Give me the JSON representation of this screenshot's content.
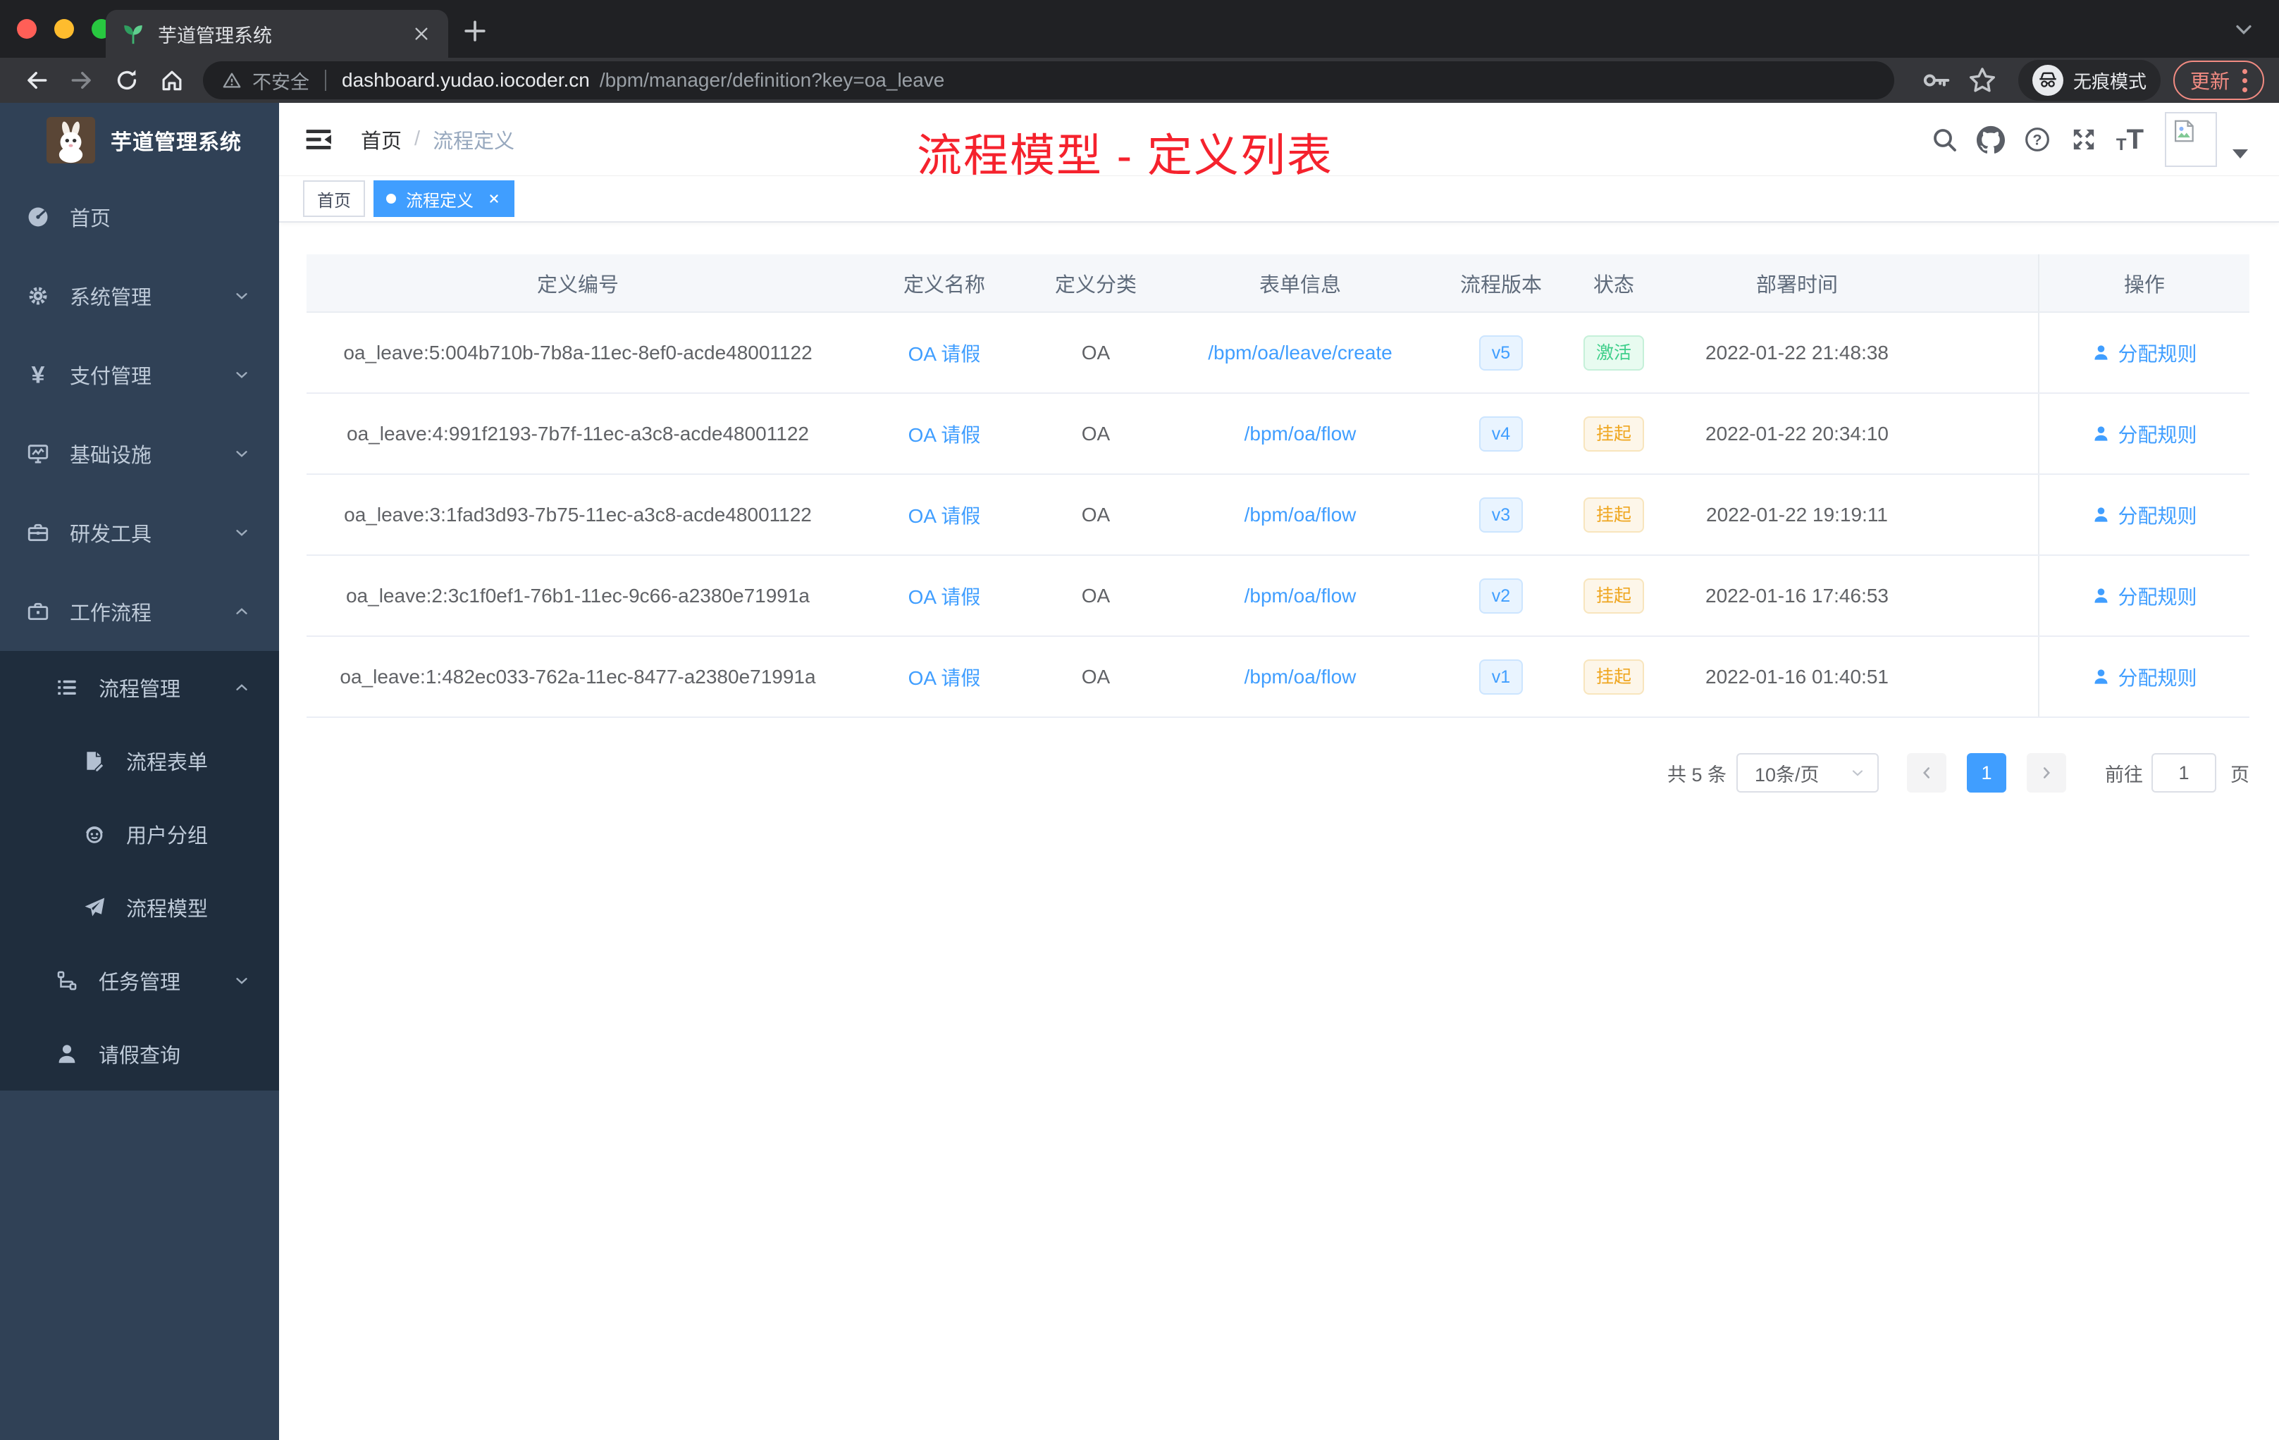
{
  "browser": {
    "tab_title": "芋道管理系统",
    "security_label": "不安全",
    "url_domain": "dashboard.yudao.iocoder.cn",
    "url_path": "/bpm/manager/definition?key=oa_leave",
    "incognito_label": "无痕模式",
    "update_label": "更新"
  },
  "sidebar": {
    "logo_title": "芋道管理系统",
    "items": [
      {
        "label": "首页"
      },
      {
        "label": "系统管理"
      },
      {
        "label": "支付管理"
      },
      {
        "label": "基础设施"
      },
      {
        "label": "研发工具"
      },
      {
        "label": "工作流程"
      },
      {
        "label": "流程管理"
      },
      {
        "label": "流程表单"
      },
      {
        "label": "用户分组"
      },
      {
        "label": "流程模型"
      },
      {
        "label": "任务管理"
      },
      {
        "label": "请假查询"
      }
    ]
  },
  "navbar": {
    "breadcrumb_home": "首页",
    "breadcrumb_sep": "/",
    "breadcrumb_current": "流程定义",
    "annotation": "流程模型 - 定义列表"
  },
  "tags": {
    "home": "首页",
    "current": "流程定义"
  },
  "table": {
    "columns": [
      "定义编号",
      "定义名称",
      "定义分类",
      "表单信息",
      "流程版本",
      "状态",
      "部署时间",
      "操作"
    ],
    "action_label": "分配规则",
    "rows": [
      {
        "id": "oa_leave:5:004b710b-7b8a-11ec-8ef0-acde48001122",
        "name": "OA 请假",
        "category": "OA",
        "form": "/bpm/oa/leave/create",
        "version": "v5",
        "status": "激活",
        "deploy_time": "2022-01-22 21:48:38"
      },
      {
        "id": "oa_leave:4:991f2193-7b7f-11ec-a3c8-acde48001122",
        "name": "OA 请假",
        "category": "OA",
        "form": "/bpm/oa/flow",
        "version": "v4",
        "status": "挂起",
        "deploy_time": "2022-01-22 20:34:10"
      },
      {
        "id": "oa_leave:3:1fad3d93-7b75-11ec-a3c8-acde48001122",
        "name": "OA 请假",
        "category": "OA",
        "form": "/bpm/oa/flow",
        "version": "v3",
        "status": "挂起",
        "deploy_time": "2022-01-22 19:19:11"
      },
      {
        "id": "oa_leave:2:3c1f0ef1-76b1-11ec-9c66-a2380e71991a",
        "name": "OA 请假",
        "category": "OA",
        "form": "/bpm/oa/flow",
        "version": "v2",
        "status": "挂起",
        "deploy_time": "2022-01-16 17:46:53"
      },
      {
        "id": "oa_leave:1:482ec033-762a-11ec-8477-a2380e71991a",
        "name": "OA 请假",
        "category": "OA",
        "form": "/bpm/oa/flow",
        "version": "v1",
        "status": "挂起",
        "deploy_time": "2022-01-16 01:40:51"
      }
    ]
  },
  "pagination": {
    "total": "共 5 条",
    "page_size": "10条/页",
    "current_page": "1",
    "goto_label": "前往",
    "goto_value": "1",
    "page_unit": "页"
  },
  "colors": {
    "accent": "#409eff",
    "success_text": "#3ecf8a",
    "warning_text": "#efa61f",
    "annotation_red": "#f5222d",
    "sidebar_bg": "#304156",
    "sidebar_submenu_bg": "#1f2d3d",
    "chrome_dark": "#202124",
    "chrome_light": "#35363a",
    "update_button": "#f28b82"
  }
}
